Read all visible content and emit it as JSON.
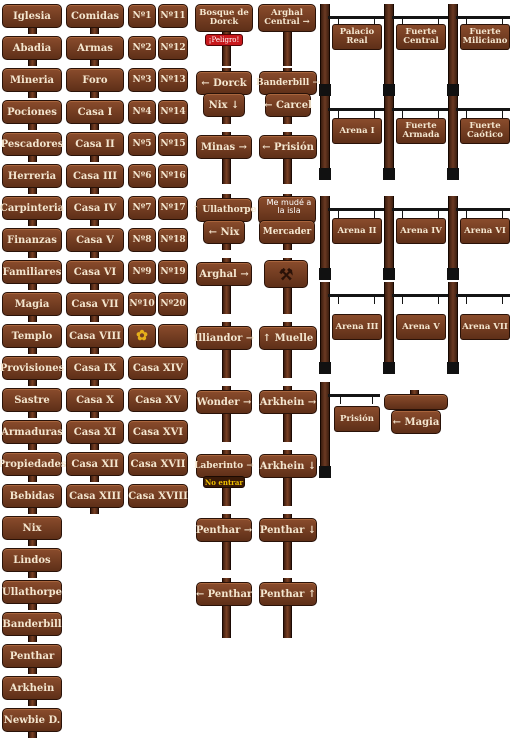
{
  "col1": [
    "Iglesia",
    "Abadia",
    "Mineria",
    "Pociones",
    "Pescadores",
    "Herreria",
    "Carpinteria",
    "Finanzas",
    "Familiares",
    "Magia",
    "Templo",
    "Provisiones",
    "Sastre",
    "Armaduras",
    "Propiedades",
    "Bebidas",
    "Nix",
    "Lindos",
    "Ullathorpe",
    "Banderbill",
    "Penthar",
    "Arkhein",
    "Newbie D."
  ],
  "col2": [
    "Comidas",
    "Armas",
    "Foro",
    "Casa I",
    "Casa II",
    "Casa III",
    "Casa IV",
    "Casa V",
    "Casa VI",
    "Casa VII",
    "Casa VIII",
    "Casa IX",
    "Casa X",
    "Casa XI",
    "Casa XII",
    "Casa XIII"
  ],
  "col3a": [
    "Nº1",
    "Nº2",
    "Nº3",
    "Nº4",
    "Nº5",
    "Nº6",
    "Nº7",
    "Nº8",
    "Nº9",
    "Nº10"
  ],
  "col3b": [
    "Nº11",
    "Nº12",
    "Nº13",
    "Nº14",
    "Nº15",
    "Nº16",
    "Nº17",
    "Nº18",
    "Nº19",
    "Nº20"
  ],
  "col3c": [
    "Casa XIV",
    "Casa XV",
    "Casa XVI",
    "Casa XVII",
    "Casa XVIII"
  ],
  "posts_left": {
    "bosque": "Bosque de Dorck",
    "peligro": "¡Peligro!",
    "dorck": "← Dorck",
    "nix": "Nix ↓",
    "minas": "Minas →",
    "ullathorpe": "↑ Ullathorpe",
    "nix2": "← Nix",
    "arghal": "Arghal →",
    "illiandor": "Illiandor →",
    "wonder": "Wonder →",
    "laberinto": "Laberinto →",
    "no_entrar": "No entrar",
    "penthar1": "Penthar →",
    "penthar2": "← Penthar"
  },
  "posts_right": {
    "arghal_central": "Arghal Central →",
    "banderbill": "Banderbill →",
    "carcel": "← Carcel",
    "prision": "← Prisión",
    "me_mude": "Me mudé a la isla",
    "mercader": "Mercader",
    "muelle": "↑ Muelle",
    "arkhein1": "Arkhein →",
    "arkhein2": "Arkhein ↓",
    "penthar1": "Penthar ↓",
    "penthar2": "Penthar ↑"
  },
  "hanging": [
    "Palacio Real",
    "Fuerte Central",
    "Fuerte Miliciano",
    "Arena I",
    "Fuerte Armada",
    "Fuerte Caótico",
    "Arena II",
    "Arena IV",
    "Arena VI",
    "Arena III",
    "Arena V",
    "Arena VII",
    "Prisión"
  ],
  "magia_sign": "← Magia"
}
